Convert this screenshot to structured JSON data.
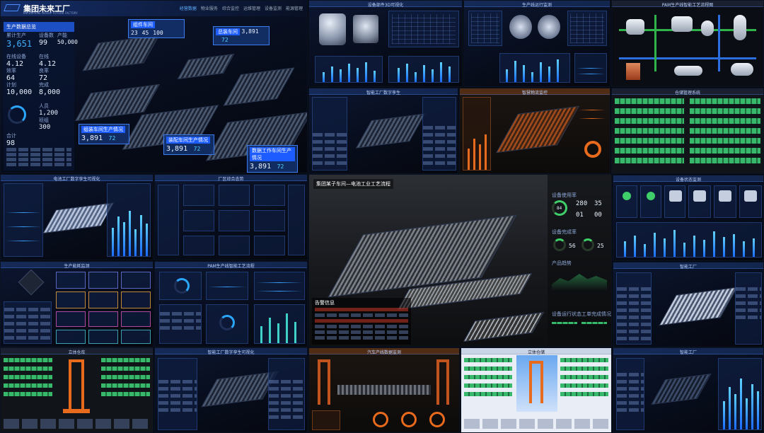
{
  "hero": {
    "brand": "集团未来工厂",
    "brand_en": "ENTERPRISE GROUP FUTURE FACTORY",
    "nav": [
      "经营数据",
      "物业服务",
      "综合监控",
      "运维管理",
      "设备监测",
      "能源管理"
    ],
    "panel_title": "生产数据总览",
    "kpis": [
      {
        "label": "累计生产",
        "value": "3,651"
      },
      {
        "label": "设备数",
        "value": "99"
      },
      {
        "label": "产能",
        "value": "50,000"
      },
      {
        "label": "在线设备",
        "value": "4.12"
      },
      {
        "label": "在线",
        "value": "4.12"
      },
      {
        "label": "效率",
        "value": "64"
      },
      {
        "label": "良率",
        "value": "72"
      },
      {
        "label": "计划",
        "value": "10,000"
      },
      {
        "label": "完成",
        "value": "8,000"
      },
      {
        "label": "人员",
        "value": "1,200"
      },
      {
        "label": "班组",
        "value": "300"
      },
      {
        "label": "合计",
        "value": "98"
      }
    ],
    "tags": [
      {
        "title": "组件车间",
        "values": [
          "23",
          "45",
          "100"
        ]
      },
      {
        "title": "总装车间",
        "value": "3,891",
        "pct": "72"
      },
      {
        "title": "组装车间生产情况",
        "value": "3,891",
        "pct": "72"
      },
      {
        "title": "装配车间生产情况",
        "value": "3,891",
        "pct": "72"
      },
      {
        "title": "数据工作车间生产情况",
        "value": "3,891",
        "pct": "72"
      }
    ]
  },
  "featured": {
    "title": "集团某子车间—电池工业工艺流程",
    "stats": [
      "280",
      "35",
      "01",
      "00"
    ],
    "metrics": [
      {
        "label": "设备使用率",
        "value": "84"
      },
      {
        "label": "设备完成率",
        "value": "56"
      },
      {
        "label": "完成率",
        "value": "25"
      }
    ],
    "section_labels": [
      "产品趋势",
      "告警信息",
      "设备运行状态",
      "工单完成情况"
    ]
  },
  "thumbs": {
    "t2_title": "设备部件3D可视化",
    "t3_title": "生产线运行监测",
    "t4_title": "PAM生产线智能工艺流程图",
    "t5_title": "智能工厂数字孪生",
    "t6_title": "智慧物流监控",
    "t7_title": "仓储管理系统",
    "t8_title": "电池工厂数字孪生可视化",
    "t9_title": "厂区综合态势",
    "t10_title": "设备状态监测",
    "t11_title": "生产能耗监测",
    "t12_title": "PAM生产线智能工艺流程",
    "t13_title": "智能工厂",
    "t14_title": "立体仓库",
    "t15_title": "智能工厂数字孪生可视化",
    "t16_title": "汽车产线数据监测",
    "t17_title": "立体仓储",
    "t18_title": "智能工厂"
  },
  "colors": {
    "accent": "#2a7bff",
    "bg": "#06080f",
    "green": "#38b86a",
    "orange": "#e86a1c"
  }
}
